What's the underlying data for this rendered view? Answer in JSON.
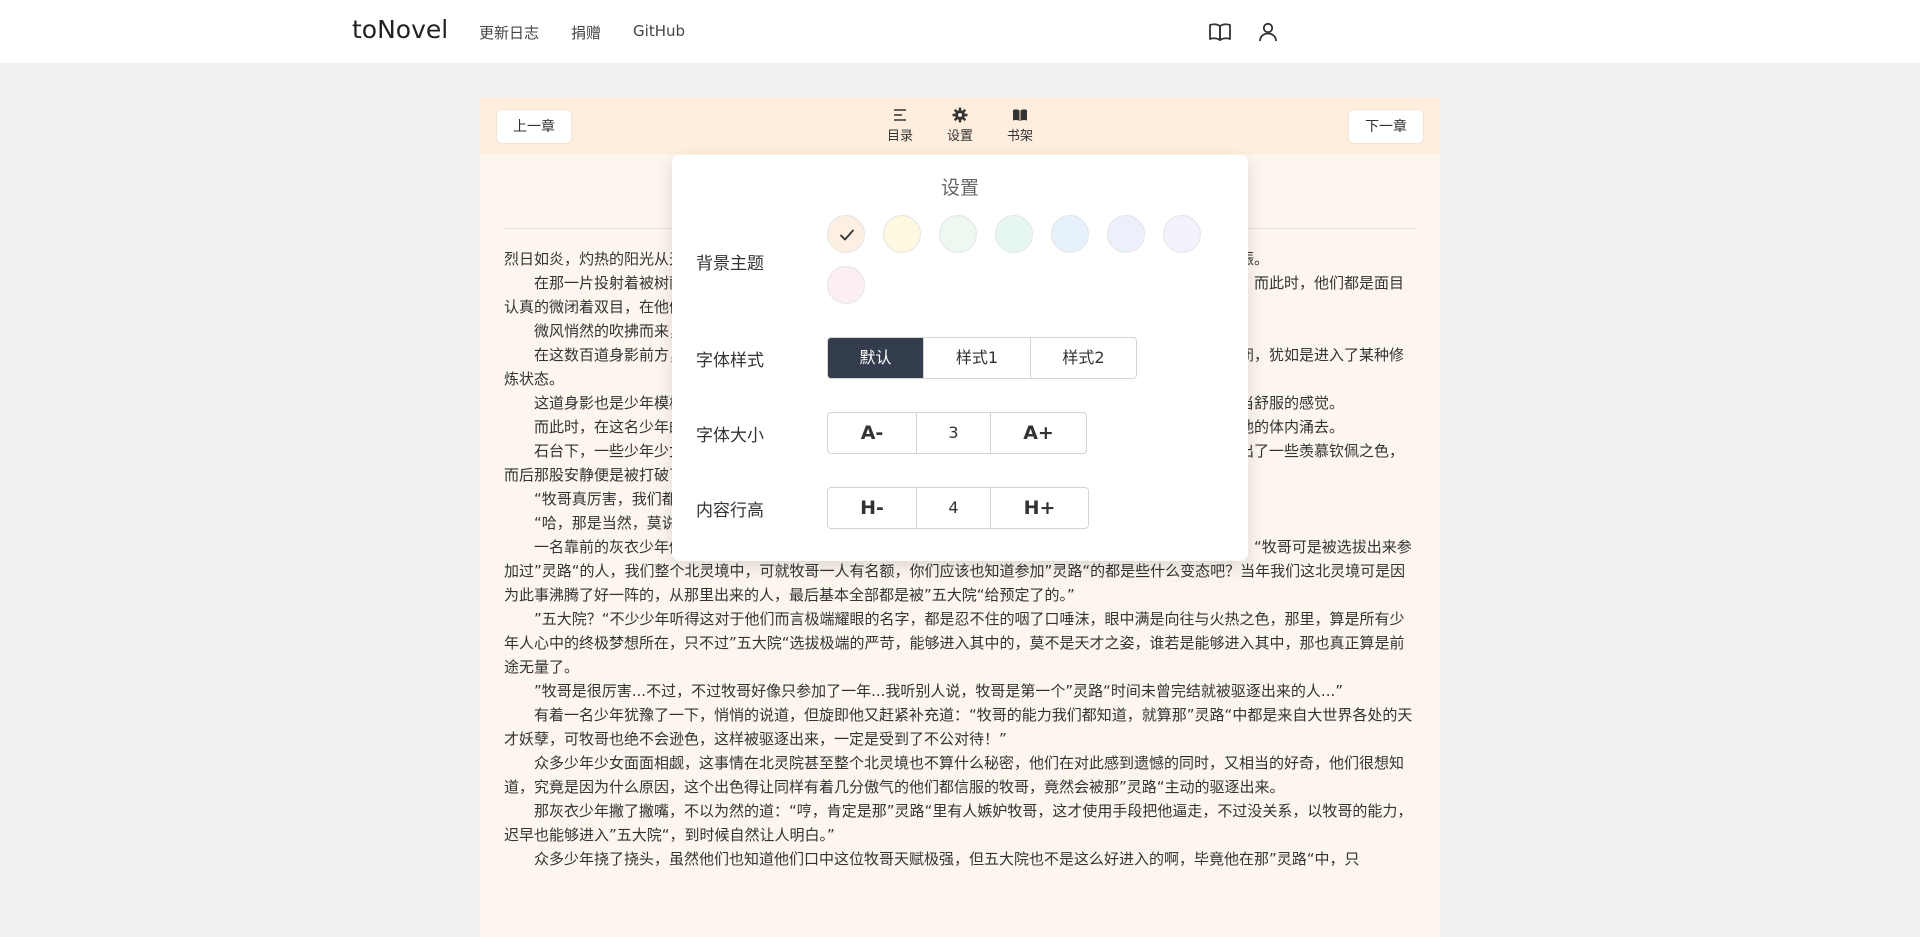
{
  "header": {
    "brand": "toNovel",
    "nav": [
      "更新日志",
      "捐赠",
      "GitHub"
    ],
    "icons": [
      "book-open-icon",
      "user-icon"
    ]
  },
  "reader_bar": {
    "prev_label": "上一章",
    "next_label": "下一章",
    "tools": [
      {
        "label": "目录",
        "icon": "list-icon"
      },
      {
        "label": "设置",
        "icon": "gear-icon"
      },
      {
        "label": "书架",
        "icon": "book-icon"
      }
    ]
  },
  "content": {
    "paragraphs": [
      "烈日如炎，灼热的阳光从天空上洒落下来，照得整片大地都是有些暑热难耐，连林间的蝉鸣声都显得有些恹恹不振。",
      "在那一片投射着被树荫所遮蔽的阴凉处，有着一座座石台，石台上，盘坐着一道道身着统一服饰的少年少女，而此时，他们都是面目认真的微闭着双目，在他们的身体周围，隐隐有着淡淡的天地能量在流淌，仿佛是有着肉眼难辨的细微光芒出现。",
      "微风悄然的吹拂而来，带起一片清凉。",
      "在这数百道身影前方，有着一座更高的石台，石台上，一名少年盘坐着，他的双手在胸前十指交叉，双目紧闭，犹如是进入了某种修炼状态。",
      "这道身影也是少年模样，他身躯修长，面庞白皙而清秀，少年的面孔虽然还有些稚嫩，但看起来有着一种相当舒服的感觉。",
      "而此时，在这名少年的周身，天地能量汹涌般的汇聚而来，最后化为一道道肉眼可见的光流能量，正在对着他的体内涌去。",
      "石台下，一些少年少女则是睁开眼睛，望着石台上那道身影，眼中也是有着羡慕之色，有些少女的脸庞上露出了一些羡慕钦佩之色，而后那股安静便是被打破了。",
      "“牧哥真厉害，我们都还在感应天地灵气，他就已经成功晋入灵动境了，真不愧是我们东院地届的第一人啊。”",
      "“哈，那是当然，莫说东院了，我想整个北灵院同等年龄中，恐怕都没几人能和牧哥比。”",
      "一名靠前的灰衣少年似乎与石台上的少年颇为熟悉，他听得大伙的窃窃私语，不由得得意一笑，压低声音道：“牧哥可是被选拔出来参加过”灵路“的人，我们整个北灵境中，可就牧哥一人有名额，你们应该也知道参加”灵路“的都是些什么变态吧？当年我们这北灵境可是因为此事沸腾了好一阵的，从那里出来的人，最后基本全部都是被”五大院“给预定了的。”",
      "”五大院？“不少少年听得这对于他们而言极端耀眼的名字，都是忍不住的咽了口唾沫，眼中满是向往与火热之色，那里，算是所有少年人心中的终极梦想所在，只不过”五大院“选拔极端的严苛，能够进入其中的，莫不是天才之姿，谁若是能够进入其中，那也真正算是前途无量了。",
      "”牧哥是很厉害...不过，不过牧哥好像只参加了一年...我听别人说，牧哥是第一个”灵路“时间未曾完结就被驱逐出来的人...”",
      "有着一名少年犹豫了一下，悄悄的说道，但旋即他又赶紧补充道：“牧哥的能力我们都知道，就算那”灵路“中都是来自大世界各处的天才妖孽，可牧哥也绝不会逊色，这样被驱逐出来，一定是受到了不公对待！”",
      "众多少年少女面面相觑，这事情在北灵院甚至整个北灵境也不算什么秘密，他们在对此感到遗憾的同时，又相当的好奇，他们很想知道，究竟是因为什么原因，这个出色得让同样有着几分傲气的他们都信服的牧哥，竟然会被那”灵路“主动的驱逐出来。",
      "那灰衣少年撇了撇嘴，不以为然的道：“哼，肯定是那”灵路“里有人嫉妒牧哥，这才使用手段把他逼走，不过没关系，以牧哥的能力，迟早也能够进入”五大院“，到时候自然让人明白。”",
      "众多少年挠了挠头，虽然他们也知道他们口中这位牧哥天赋极强，但五大院也不是这么好进入的啊，毕竟他在那”灵路“中，只"
    ]
  },
  "settings": {
    "title": "设置",
    "theme_label": "背景主题",
    "theme_colors": [
      "#fdf0e2",
      "#fdf9e0",
      "#edf8f1",
      "#e6f7f3",
      "#e7f1fc",
      "#ecf0fb",
      "#f3f1fc",
      "#fceff3"
    ],
    "theme_selected_index": 0,
    "font_style_label": "字体样式",
    "font_styles": [
      "默认",
      "样式1",
      "样式2"
    ],
    "font_style_selected_index": 0,
    "font_size_label": "字体大小",
    "font_size": {
      "decrease": "A-",
      "value": "3",
      "increase": "A+"
    },
    "line_height_label": "内容行高",
    "line_height": {
      "decrease": "H-",
      "value": "4",
      "increase": "H+"
    }
  }
}
